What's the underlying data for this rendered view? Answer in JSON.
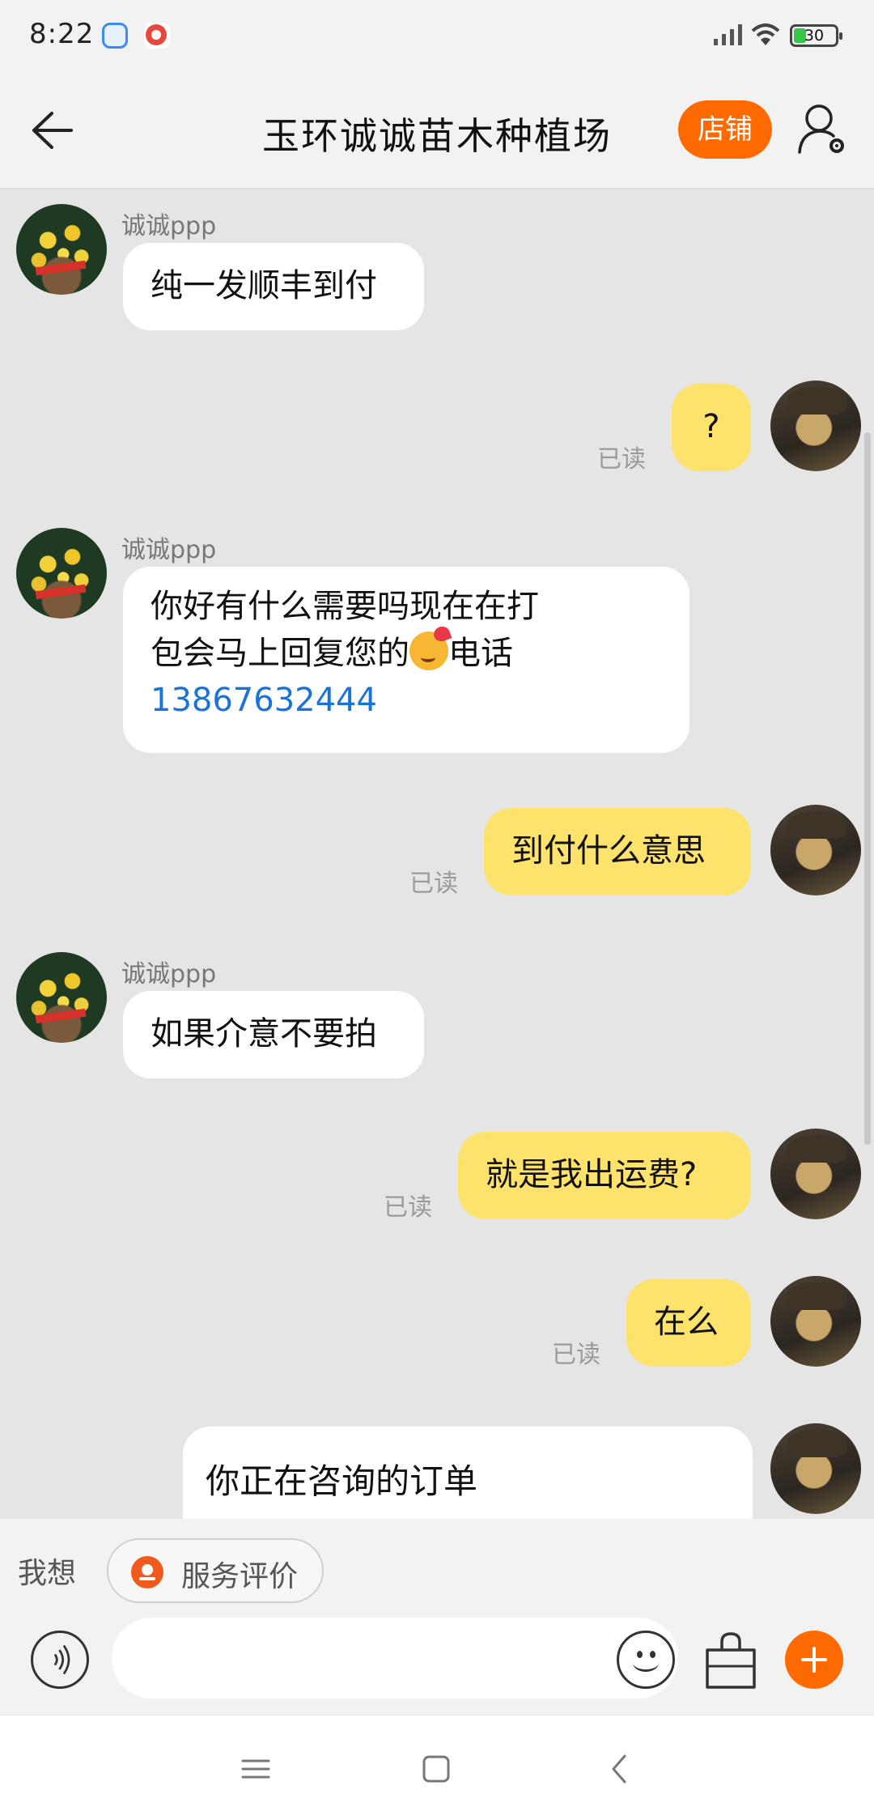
{
  "status_bar": {
    "time": "8:22",
    "battery": "30",
    "battery_level": 0.3
  },
  "header": {
    "title": "玉环诚诚苗木种植场",
    "shop_label": "店铺"
  },
  "shop": {
    "sender_name": "诚诚ppp"
  },
  "messages": [
    {
      "from": "shop",
      "text": "纯一发顺丰到付"
    },
    {
      "from": "me",
      "text": "?",
      "read": "已读"
    },
    {
      "from": "shop",
      "line1": "你好有什么需要吗现在在打",
      "line2": "包会马上回复您的",
      "line2_after": "电话",
      "phone": "13867632444"
    },
    {
      "from": "me",
      "text": "到付什么意思",
      "read": "已读"
    },
    {
      "from": "shop",
      "text": "如果介意不要拍"
    },
    {
      "from": "me",
      "text": "就是我出运费?",
      "read": "已读"
    },
    {
      "from": "me",
      "text": "在么",
      "read": "已读"
    }
  ],
  "order_card": {
    "title": "你正在咨询的订单"
  },
  "quick_bar": {
    "label": "我想",
    "chip": "服务评价"
  },
  "input": {
    "value": "",
    "placeholder": ""
  },
  "icons": {
    "back": "arrow-left-icon",
    "user": "user-settings-icon",
    "voice": "voice-icon",
    "emoji": "emoji-icon",
    "bag": "shopping-bag-icon",
    "plus": "plus-icon"
  },
  "colors": {
    "accent": "#ff6a00",
    "outgoing_bubble": "#fde26c",
    "incoming_bubble": "#ffffff",
    "link": "#1a73d8",
    "chat_bg": "#e5e5e5"
  }
}
